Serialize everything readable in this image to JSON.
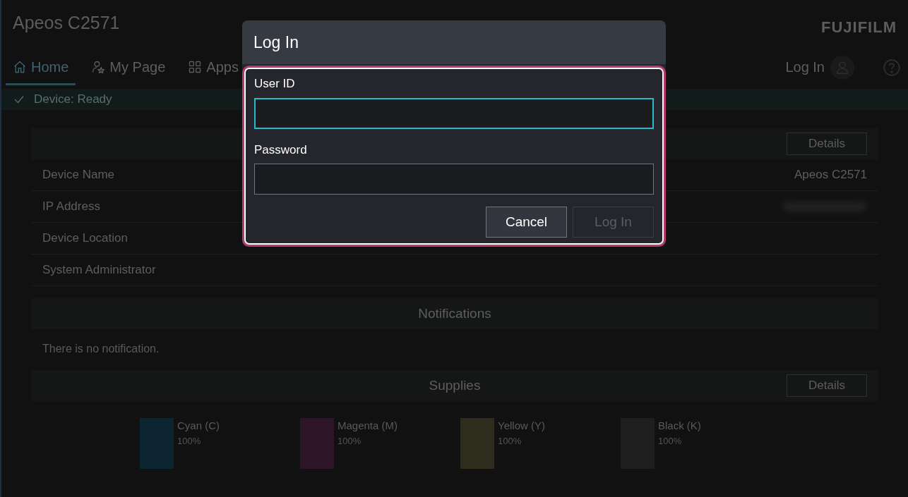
{
  "app": {
    "title": "Apeos C2571",
    "logo": "FUJIFILM"
  },
  "nav_tabs": [
    {
      "label": "Home",
      "selected": true
    },
    {
      "label": "My Page",
      "selected": false
    },
    {
      "label": "Apps",
      "selected": false
    }
  ],
  "header_actions": {
    "login_label": "Log In"
  },
  "status": {
    "text": "Device: Ready"
  },
  "device_info": {
    "details_button": "Details",
    "rows": [
      {
        "label": "Device Name",
        "kind": "text",
        "value": "Apeos C2571"
      },
      {
        "label": "IP Address",
        "kind": "blurred"
      },
      {
        "label": "Device Location",
        "kind": "text"
      },
      {
        "label": "System Administrator",
        "kind": "text"
      }
    ]
  },
  "notifications": {
    "title": "Notifications",
    "message": "There is no notification."
  },
  "supplies": {
    "title": "Supplies",
    "details_button": "Details",
    "items": [
      {
        "name": "Cyan (C)",
        "reading": "100%",
        "color": "#0c2530"
      },
      {
        "name": "Magenta (M)",
        "reading": "100%",
        "color": "#2e1628"
      },
      {
        "name": "Yellow (Y)",
        "reading": "100%",
        "color": "#2e2c1c"
      },
      {
        "name": "Black (K)",
        "reading": "100%",
        "color": "#1f1f1f"
      }
    ]
  },
  "dialog": {
    "title": "Log In",
    "fields": [
      {
        "label": "User ID",
        "focused": true
      },
      {
        "label": "Password",
        "focused": false
      }
    ],
    "buttons": [
      {
        "label": "Cancel",
        "disabled": false
      },
      {
        "label": "Log In",
        "disabled": true
      }
    ]
  }
}
